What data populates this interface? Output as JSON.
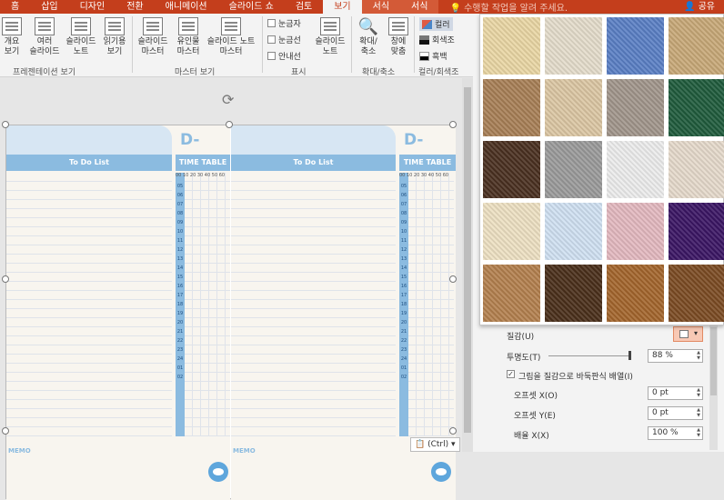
{
  "tabs": [
    "홈",
    "삽입",
    "디자인",
    "전환",
    "애니메이션",
    "슬라이드 쇼",
    "검토",
    "보기",
    "서식",
    "서식"
  ],
  "active_tab": "보기",
  "tell_me": "수행할 작업을 알려 주세요.",
  "share": "공유",
  "ribbon": {
    "presentation_views": [
      {
        "label": "개요\n보기"
      },
      {
        "label": "여러\n슬라이드"
      },
      {
        "label": "슬라이드\n노트"
      },
      {
        "label": "읽기용\n보기"
      }
    ],
    "group_presentation": "프레젠테이션 보기",
    "master_views": [
      {
        "label": "슬라이드\n마스터"
      },
      {
        "label": "유인물\n마스터"
      },
      {
        "label": "슬라이드 노트\n마스터"
      }
    ],
    "group_master": "마스터 보기",
    "show": {
      "ruler": "눈금자",
      "gridlines": "눈금선",
      "guides": "안내선",
      "notes_label": "슬라이드\n노트"
    },
    "group_show": "표시",
    "zoom": {
      "zoom_label": "확대/\n축소",
      "fit_label": "창에\n맞춤"
    },
    "group_zoom": "확대/축소",
    "color": {
      "color_label": "컬러",
      "gray_label": "회색조",
      "bw_label": "흑백"
    },
    "group_color": "컬러/회색조"
  },
  "slide": {
    "left_planner": {
      "d_label": "D-",
      "todo": "To Do List",
      "time": "TIME TABLE",
      "memo": "MEMO"
    },
    "right_planner": {
      "d_label": "D-",
      "todo": "To Do List",
      "time": "TIME TABLE",
      "memo": "MEMO"
    },
    "time_header": "00 10 20 30 40 50 60",
    "hours": [
      "05",
      "06",
      "07",
      "08",
      "09",
      "10",
      "11",
      "12",
      "13",
      "14",
      "15",
      "16",
      "17",
      "18",
      "19",
      "20",
      "21",
      "22",
      "23",
      "24",
      "01",
      "02"
    ]
  },
  "paste_tag": "(Ctrl)",
  "format_panel": {
    "texture_label": "질감(U)",
    "transparency_label": "투명도(T)",
    "transparency_value": "88 %",
    "transparency_level": 0.88,
    "tile_label": "그림을 질감으로 바둑판식 배열(I)",
    "tile_checked": true,
    "offset_x_label": "오프셋 X(O)",
    "offset_x_value": "0 pt",
    "offset_y_label": "오프셋 Y(E)",
    "offset_y_value": "0 pt",
    "scale_x_label": "배율 X(X)",
    "scale_x_value": "100 %"
  },
  "textures": [
    {
      "name": "papyrus",
      "color": "#e9d6a4"
    },
    {
      "name": "canvas",
      "color": "#e4dccb"
    },
    {
      "name": "denim",
      "color": "#5a7fc4"
    },
    {
      "name": "woven-mat",
      "color": "#c7a877"
    },
    {
      "name": "paper-bag",
      "color": "#a77f56"
    },
    {
      "name": "fish-fossil",
      "color": "#dbc6a3"
    },
    {
      "name": "sand",
      "color": "#a1958b"
    },
    {
      "name": "green-marble",
      "color": "#1f5b3c"
    },
    {
      "name": "white-marble",
      "color": "#4a3020"
    },
    {
      "name": "granite",
      "color": "#9a9a9a"
    },
    {
      "name": "white-paper",
      "color": "#ececec"
    },
    {
      "name": "parchment",
      "color": "#e5d9cb"
    },
    {
      "name": "cream",
      "color": "#ede0c2"
    },
    {
      "name": "blue-tissue",
      "color": "#cfe0f1"
    },
    {
      "name": "pink-tissue",
      "color": "#e3b8bf"
    },
    {
      "name": "purple-mesh",
      "color": "#3b1664"
    },
    {
      "name": "cork",
      "color": "#b3804e"
    },
    {
      "name": "walnut",
      "color": "#4a2f1a"
    },
    {
      "name": "oak",
      "color": "#a3652c"
    },
    {
      "name": "medium-wood",
      "color": "#7b4b23"
    }
  ],
  "colors": {
    "accent": "#c43e1c",
    "planner_blue": "#8bbbe0"
  }
}
